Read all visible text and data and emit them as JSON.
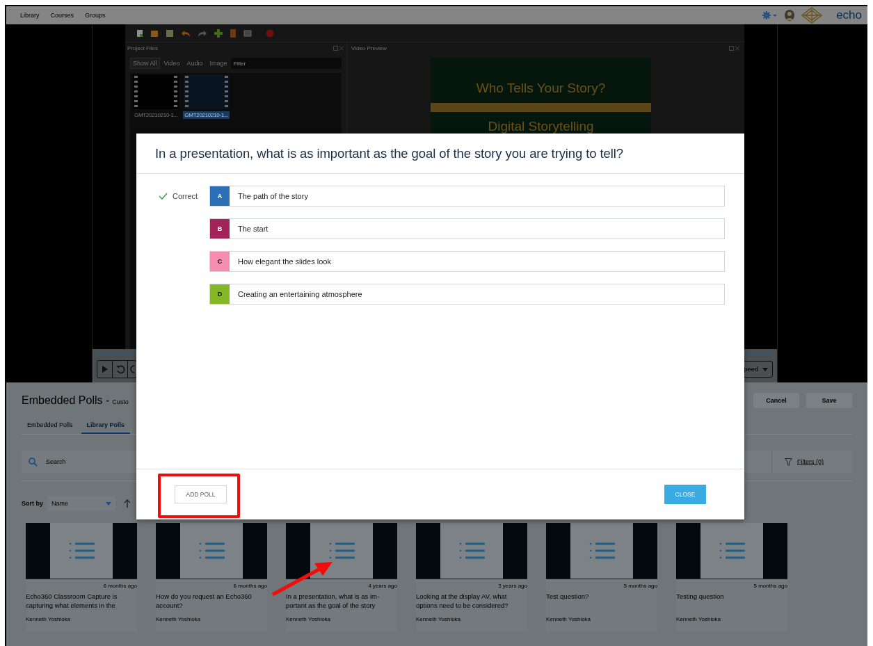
{
  "nav": {
    "items": [
      "Library",
      "Courses",
      "Groups"
    ],
    "logo_text": "echo"
  },
  "editor": {
    "files_title": "Project Files",
    "preview_title": "Video Preview",
    "filters": [
      {
        "label": "Show All",
        "selected": true
      },
      {
        "label": "Video",
        "selected": false
      },
      {
        "label": "Audio",
        "selected": false
      },
      {
        "label": "Image",
        "selected": false
      }
    ],
    "filter_placeholder": "Filter",
    "files": [
      {
        "name": "GMT20210210-1...",
        "selected": false
      },
      {
        "name": "GMT20210210-1...",
        "selected": true
      }
    ],
    "slide": {
      "title": "Who Tells Your Story?",
      "subtitle": "Digital Storytelling"
    },
    "speed": "peed"
  },
  "page": {
    "title": "Embedded Polls -",
    "subtitle": "Custo",
    "buttons": [
      "Cancel",
      "Save"
    ],
    "tabs": [
      {
        "label": "Embedded Polls",
        "selected": false
      },
      {
        "label": "Library Polls",
        "selected": true
      }
    ],
    "search_placeholder": "Search",
    "filters_link": "Filters (0)",
    "sort_label": "Sort by",
    "sort_value": "Name"
  },
  "cards": [
    {
      "age": "6 months ago",
      "title": "Echo360 Classroom Capture is capturing what elements in the",
      "author": "Kenneth Yoshioka"
    },
    {
      "age": "6 months ago",
      "title": "How do you request an Echo360 account?",
      "author": "Kenneth Yoshioka"
    },
    {
      "age": "4 years ago",
      "title": "In a presentation, what is as im-portant as the goal of the story",
      "author": "Kenneth Yoshioka"
    },
    {
      "age": "3 years ago",
      "title": "Looking at the display AV, what options need to be considered?",
      "author": "Kenneth Yoshioka"
    },
    {
      "age": "5 months ago",
      "title": "Test question?",
      "author": "Kenneth Yoshioka"
    },
    {
      "age": "5 months ago",
      "title": "Testing question",
      "author": "Kenneth Yoshioka"
    }
  ],
  "modal": {
    "question": "In a presentation, what is as important as the goal of the story you are trying to tell?",
    "correct_label": "Correct",
    "options": [
      {
        "letter": "A",
        "text": "The path of the story",
        "color": "#2b6fb6",
        "correct": true
      },
      {
        "letter": "B",
        "text": "The start",
        "color": "#a3245a",
        "correct": false
      },
      {
        "letter": "C",
        "text": "How elegant the slides look",
        "color": "#f58db0",
        "correct": false
      },
      {
        "letter": "D",
        "text": "Creating an entertaining atmosphere",
        "color": "#85b827",
        "correct": false
      }
    ],
    "add_button": "ADD POLL",
    "close_button": "CLOSE"
  }
}
